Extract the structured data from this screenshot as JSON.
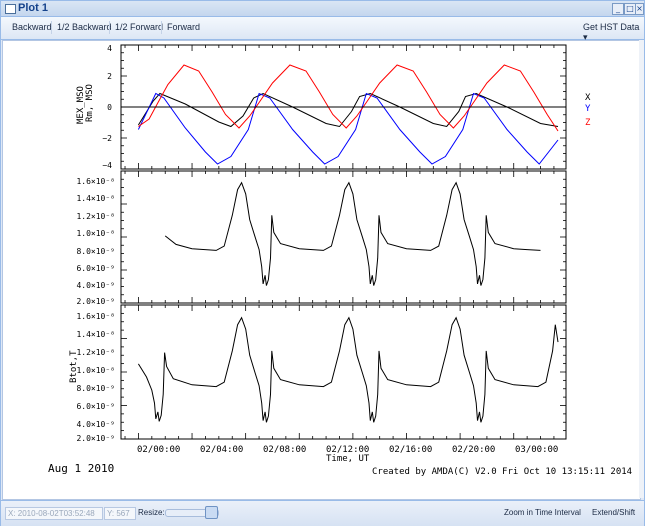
{
  "window": {
    "title": "Plot 1"
  },
  "toolbar": {
    "backward": "Backward",
    "half_backward": "1/2 Backward",
    "half_forward": "1/2 Forward",
    "forward": "Forward",
    "get_hst": "Get HST Data ▾"
  },
  "plot": {
    "panel1": {
      "ylabel_line1": "MEX_MSO",
      "ylabel_line2": "Rm, MSO",
      "yticks": [
        "4",
        "2",
        "0",
        "−2",
        "−4"
      ],
      "legend": [
        "X",
        "Y",
        "Z"
      ],
      "legend_colors": [
        "#000000",
        "#0000ff",
        "#ff0000"
      ]
    },
    "panel2": {
      "yticks": [
        "1.6×10⁻⁸",
        "1.4×10⁻⁸",
        "1.2×10⁻⁸",
        "1.0×10⁻⁸",
        "8.0×10⁻⁹",
        "6.0×10⁻⁹",
        "4.0×10⁻⁹",
        "2.0×10⁻⁹"
      ]
    },
    "panel3": {
      "ylabel": "Btot,T",
      "yticks": [
        "1.6×10⁻⁸",
        "1.4×10⁻⁸",
        "1.2×10⁻⁸",
        "1.0×10⁻⁸",
        "8.0×10⁻⁹",
        "6.0×10⁻⁹",
        "4.0×10⁻⁹",
        "2.0×10⁻⁹"
      ]
    },
    "xticks": [
      "02/00:00",
      "02/04:00",
      "02/08:00",
      "02/12:00",
      "02/16:00",
      "02/20:00",
      "03/00:00"
    ],
    "xlabel": "Time, UT",
    "date": "Aug  1 2010",
    "credits": "Created by AMDA(C) V2.0 Fri Oct 10 13:15:11 2014"
  },
  "statusbar": {
    "x_field": "X: 2010-08-02T03:52:48",
    "y_field": "Y: 567",
    "resize_label": "Resize:",
    "zoom": "Zoom in Time Interval",
    "extend": "Extend/Shift"
  },
  "chart_data": {
    "type": "line",
    "x_unit": "hours after 2010-08-01 20:00 UT",
    "panels": [
      {
        "ylabel": "MEX_MSO Rm, MSO",
        "ylim": [
          -4,
          4
        ],
        "series": [
          {
            "name": "X",
            "color": "#000000",
            "points": [
              [
                0,
                -1.2
              ],
              [
                1.1,
                0.4
              ],
              [
                1.6,
                0.9
              ],
              [
                3.5,
                0.2
              ],
              [
                6.0,
                -1.0
              ],
              [
                6.9,
                -1.3
              ],
              [
                7.8,
                -0.6
              ],
              [
                8.6,
                0.6
              ],
              [
                9.3,
                0.9
              ],
              [
                11.5,
                0.0
              ],
              [
                14.0,
                -1.1
              ],
              [
                15.0,
                -1.3
              ],
              [
                15.9,
                -0.3
              ],
              [
                16.5,
                0.7
              ],
              [
                17.3,
                0.9
              ],
              [
                19.5,
                0.0
              ],
              [
                22.0,
                -1.1
              ],
              [
                23.0,
                -1.3
              ],
              [
                23.9,
                -0.3
              ],
              [
                24.4,
                0.7
              ],
              [
                25.2,
                0.9
              ],
              [
                27.5,
                0.0
              ],
              [
                30.0,
                -1.1
              ],
              [
                31.3,
                -1.3
              ]
            ]
          },
          {
            "name": "Y",
            "color": "#0000ff",
            "points": [
              [
                0,
                -1.5
              ],
              [
                1.3,
                0.9
              ],
              [
                1.9,
                0.6
              ],
              [
                3.5,
                -1.4
              ],
              [
                5.0,
                -3.0
              ],
              [
                5.9,
                -3.8
              ],
              [
                6.9,
                -3.3
              ],
              [
                8.2,
                -1.5
              ],
              [
                9.0,
                0.9
              ],
              [
                9.8,
                0.6
              ],
              [
                11.5,
                -1.5
              ],
              [
                13.0,
                -3.0
              ],
              [
                13.9,
                -3.8
              ],
              [
                14.9,
                -3.3
              ],
              [
                16.2,
                -1.5
              ],
              [
                17.0,
                0.9
              ],
              [
                17.8,
                0.6
              ],
              [
                19.5,
                -1.5
              ],
              [
                21.0,
                -3.0
              ],
              [
                21.9,
                -3.8
              ],
              [
                22.9,
                -3.3
              ],
              [
                24.2,
                -1.5
              ],
              [
                25.0,
                0.9
              ],
              [
                25.8,
                0.6
              ],
              [
                27.5,
                -1.5
              ],
              [
                29.0,
                -3.0
              ],
              [
                29.9,
                -3.8
              ],
              [
                31.3,
                -2.2
              ]
            ]
          },
          {
            "name": "Z",
            "color": "#ff0000",
            "points": [
              [
                0,
                -1.3
              ],
              [
                0.8,
                -0.8
              ],
              [
                1.4,
                0.2
              ],
              [
                2.2,
                1.5
              ],
              [
                3.4,
                2.8
              ],
              [
                4.5,
                2.4
              ],
              [
                5.5,
                1.0
              ],
              [
                6.5,
                -0.5
              ],
              [
                7.5,
                -1.4
              ],
              [
                8.3,
                -0.6
              ],
              [
                9.0,
                0.3
              ],
              [
                10.0,
                1.6
              ],
              [
                11.3,
                2.8
              ],
              [
                12.5,
                2.4
              ],
              [
                13.5,
                1.0
              ],
              [
                14.5,
                -0.5
              ],
              [
                15.5,
                -1.4
              ],
              [
                16.3,
                -0.6
              ],
              [
                17.0,
                0.3
              ],
              [
                18.0,
                1.6
              ],
              [
                19.3,
                2.8
              ],
              [
                20.5,
                2.4
              ],
              [
                21.5,
                1.0
              ],
              [
                22.5,
                -0.5
              ],
              [
                23.5,
                -1.4
              ],
              [
                24.3,
                -0.6
              ],
              [
                25.0,
                0.3
              ],
              [
                26.0,
                1.6
              ],
              [
                27.3,
                2.8
              ],
              [
                28.5,
                2.4
              ],
              [
                29.5,
                1.0
              ],
              [
                30.5,
                -0.5
              ],
              [
                31.3,
                -1.6
              ]
            ]
          }
        ]
      },
      {
        "ylabel": "",
        "ylim": [
          1.8e-09,
          1.7e-08
        ],
        "series": [
          {
            "name": "",
            "color": "#000000",
            "points": [
              [
                2.0,
                9.6e-09
              ],
              [
                2.8,
                8.6e-09
              ],
              [
                4.0,
                8.1e-09
              ],
              [
                5.8,
                7.9e-09
              ],
              [
                6.4,
                8.4e-09
              ],
              [
                7.0,
                1.2e-08
              ],
              [
                7.4,
                1.5e-08
              ],
              [
                7.7,
                1.58e-08
              ],
              [
                8.0,
                1.45e-08
              ],
              [
                8.3,
                1.15e-08
              ],
              [
                8.7,
                9.5e-09
              ],
              [
                9.0,
                8e-09
              ],
              [
                9.2,
                6e-09
              ],
              [
                9.3,
                4e-09
              ],
              [
                9.45,
                5e-09
              ],
              [
                9.55,
                3.8e-09
              ],
              [
                9.7,
                4.5e-09
              ],
              [
                9.85,
                7e-09
              ],
              [
                9.95,
                1.2e-08
              ],
              [
                10.1,
                1e-08
              ],
              [
                10.6,
                8.7e-09
              ],
              [
                12.0,
                8.1e-09
              ],
              [
                13.8,
                7.9e-09
              ],
              [
                14.4,
                8.4e-09
              ],
              [
                15.0,
                1.2e-08
              ],
              [
                15.4,
                1.5e-08
              ],
              [
                15.7,
                1.58e-08
              ],
              [
                16.0,
                1.45e-08
              ],
              [
                16.3,
                1.15e-08
              ],
              [
                16.7,
                9.5e-09
              ],
              [
                17.0,
                8e-09
              ],
              [
                17.2,
                6e-09
              ],
              [
                17.3,
                4e-09
              ],
              [
                17.45,
                5e-09
              ],
              [
                17.55,
                3.8e-09
              ],
              [
                17.7,
                4.5e-09
              ],
              [
                17.85,
                7e-09
              ],
              [
                17.95,
                1.2e-08
              ],
              [
                18.1,
                1e-08
              ],
              [
                18.6,
                8.7e-09
              ],
              [
                20.0,
                8.1e-09
              ],
              [
                21.8,
                7.9e-09
              ],
              [
                22.4,
                8.4e-09
              ],
              [
                23.0,
                1.2e-08
              ],
              [
                23.4,
                1.5e-08
              ],
              [
                23.7,
                1.58e-08
              ],
              [
                24.0,
                1.45e-08
              ],
              [
                24.3,
                1.15e-08
              ],
              [
                24.7,
                9.5e-09
              ],
              [
                25.0,
                8e-09
              ],
              [
                25.2,
                6e-09
              ],
              [
                25.3,
                4e-09
              ],
              [
                25.45,
                5e-09
              ],
              [
                25.55,
                3.8e-09
              ],
              [
                25.7,
                4.5e-09
              ],
              [
                25.85,
                7e-09
              ],
              [
                25.95,
                1.2e-08
              ],
              [
                26.1,
                1e-08
              ],
              [
                26.6,
                8.7e-09
              ],
              [
                28.0,
                8.1e-09
              ],
              [
                29.0,
                8e-09
              ],
              [
                30.0,
                7.9e-09
              ]
            ]
          }
        ]
      },
      {
        "ylabel": "Btot,T",
        "ylim": [
          1.8e-09,
          1.7e-08
        ],
        "series": [
          {
            "name": "",
            "color": "#000000",
            "points": [
              [
                0.0,
                1.05e-08
              ],
              [
                0.6,
                9e-09
              ],
              [
                1.0,
                7.5e-09
              ],
              [
                1.2,
                6e-09
              ],
              [
                1.3,
                4.2e-09
              ],
              [
                1.45,
                5e-09
              ],
              [
                1.55,
                3.9e-09
              ],
              [
                1.7,
                4.6e-09
              ],
              [
                1.85,
                7e-09
              ],
              [
                1.95,
                1.18e-08
              ],
              [
                2.1,
                1.02e-08
              ],
              [
                2.6,
                8.8e-09
              ],
              [
                4.0,
                8.1e-09
              ],
              [
                5.8,
                7.9e-09
              ],
              [
                6.4,
                8.4e-09
              ],
              [
                7.0,
                1.2e-08
              ],
              [
                7.4,
                1.5e-08
              ],
              [
                7.7,
                1.58e-08
              ],
              [
                8.0,
                1.45e-08
              ],
              [
                8.3,
                1.15e-08
              ],
              [
                8.7,
                9.5e-09
              ],
              [
                9.0,
                8e-09
              ],
              [
                9.2,
                6e-09
              ],
              [
                9.3,
                4e-09
              ],
              [
                9.45,
                5e-09
              ],
              [
                9.55,
                3.8e-09
              ],
              [
                9.7,
                4.5e-09
              ],
              [
                9.85,
                7e-09
              ],
              [
                9.95,
                1.2e-08
              ],
              [
                10.1,
                1e-08
              ],
              [
                10.6,
                8.7e-09
              ],
              [
                12.0,
                8.1e-09
              ],
              [
                13.8,
                7.9e-09
              ],
              [
                14.4,
                8.4e-09
              ],
              [
                15.0,
                1.2e-08
              ],
              [
                15.4,
                1.5e-08
              ],
              [
                15.7,
                1.58e-08
              ],
              [
                16.0,
                1.45e-08
              ],
              [
                16.3,
                1.15e-08
              ],
              [
                16.7,
                9.5e-09
              ],
              [
                17.0,
                8e-09
              ],
              [
                17.2,
                6e-09
              ],
              [
                17.3,
                4e-09
              ],
              [
                17.45,
                5e-09
              ],
              [
                17.55,
                3.8e-09
              ],
              [
                17.7,
                4.5e-09
              ],
              [
                17.85,
                7e-09
              ],
              [
                17.95,
                1.2e-08
              ],
              [
                18.1,
                1e-08
              ],
              [
                18.6,
                8.7e-09
              ],
              [
                20.0,
                8.1e-09
              ],
              [
                21.8,
                7.9e-09
              ],
              [
                22.4,
                8.4e-09
              ],
              [
                23.0,
                1.2e-08
              ],
              [
                23.4,
                1.5e-08
              ],
              [
                23.7,
                1.58e-08
              ],
              [
                24.0,
                1.45e-08
              ],
              [
                24.3,
                1.15e-08
              ],
              [
                24.7,
                9.5e-09
              ],
              [
                25.0,
                8e-09
              ],
              [
                25.2,
                6e-09
              ],
              [
                25.3,
                4e-09
              ],
              [
                25.45,
                5e-09
              ],
              [
                25.55,
                3.8e-09
              ],
              [
                25.7,
                4.5e-09
              ],
              [
                25.85,
                7e-09
              ],
              [
                25.95,
                1.2e-08
              ],
              [
                26.1,
                1e-08
              ],
              [
                26.6,
                8.7e-09
              ],
              [
                28.0,
                8.1e-09
              ],
              [
                29.8,
                7.9e-09
              ],
              [
                30.4,
                8.4e-09
              ],
              [
                30.9,
                1.2e-08
              ],
              [
                31.1,
                1.5e-08
              ],
              [
                31.3,
                1.3e-08
              ]
            ]
          }
        ]
      }
    ]
  }
}
